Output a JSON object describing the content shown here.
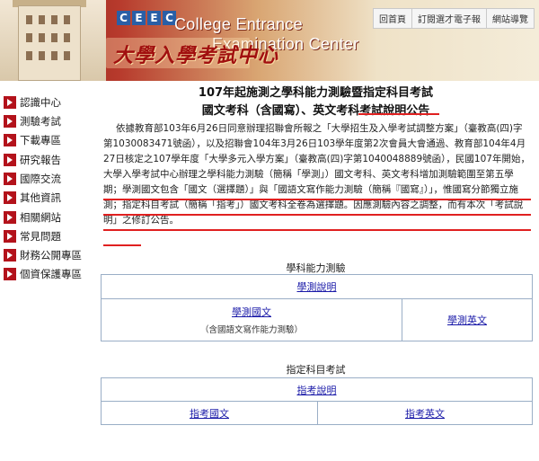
{
  "header": {
    "badge_letters": [
      "C",
      "E",
      "E",
      "C"
    ],
    "title_en_line1": "College Entrance",
    "title_en_line2": "Examination Center",
    "title_zh": "大學入學考試中心",
    "top_links": [
      "回首頁",
      "訂閱選才電子報",
      "網站導覽"
    ],
    "colors": {
      "brand_red": "#a10f0f",
      "badge_blue": "#2a5fa6"
    }
  },
  "sidebar": {
    "items": [
      {
        "label": "認識中心",
        "icon": "red-arrow-icon"
      },
      {
        "label": "測驗考試",
        "icon": "red-arrow-icon"
      },
      {
        "label": "下載專區",
        "icon": "red-arrow-icon"
      },
      {
        "label": "研究報告",
        "icon": "red-arrow-icon"
      },
      {
        "label": "國際交流",
        "icon": "red-arrow-icon"
      },
      {
        "label": "其他資訊",
        "icon": "red-arrow-icon"
      },
      {
        "label": "相關網站",
        "icon": "red-arrow-icon"
      },
      {
        "label": "常見問題",
        "icon": "red-arrow-icon"
      },
      {
        "label": "財務公開專區",
        "icon": "red-arrow-icon"
      },
      {
        "label": "個資保護專區",
        "icon": "red-arrow-icon"
      }
    ]
  },
  "main": {
    "title": "107年起施測之學科能力測驗暨指定科目考試",
    "subtitle": "國文考科（含國寫）、英文考科考試說明公告",
    "intro": "依據教育部103年6月26日同意辦理招聯會所報之「大學招生及入學考試調整方案」（臺教高(四)字第1030083471號函），以及招聯會104年3月26日103學年度第2次會員大會通過、教育部104年4月27日核定之107學年度「大學多元入學方案」（臺教高(四)字第1040048889號函），民國107年開始，大學入學考試中心辦理之學科能力測驗（簡稱「學測」）國文考科、英文考科增加測驗範圍至第五學期；學測國文包含「國文（選擇題）」與「國語文寫作能力測驗（簡稱『國寫』）」，惟國寫分節獨立施測；指定科目考試（簡稱「指考」）國文考科全卷為選擇題。因應測驗內容之調整，而有本次「考試說明」之修訂公告。",
    "gsat": {
      "section_title": "學科能力測驗",
      "overview_link": "學測說明",
      "chinese_link": "學測國文",
      "chinese_note": "（含國語文寫作能力測驗）",
      "english_link": "學測英文"
    },
    "ast": {
      "section_title": "指定科目考試",
      "overview_link": "指考說明",
      "chinese_link": "指考國文",
      "english_link": "指考英文"
    },
    "colors": {
      "link": "#1a1aa8",
      "underline_annotation": "#e02020",
      "table_border": "#9aaec6"
    }
  }
}
